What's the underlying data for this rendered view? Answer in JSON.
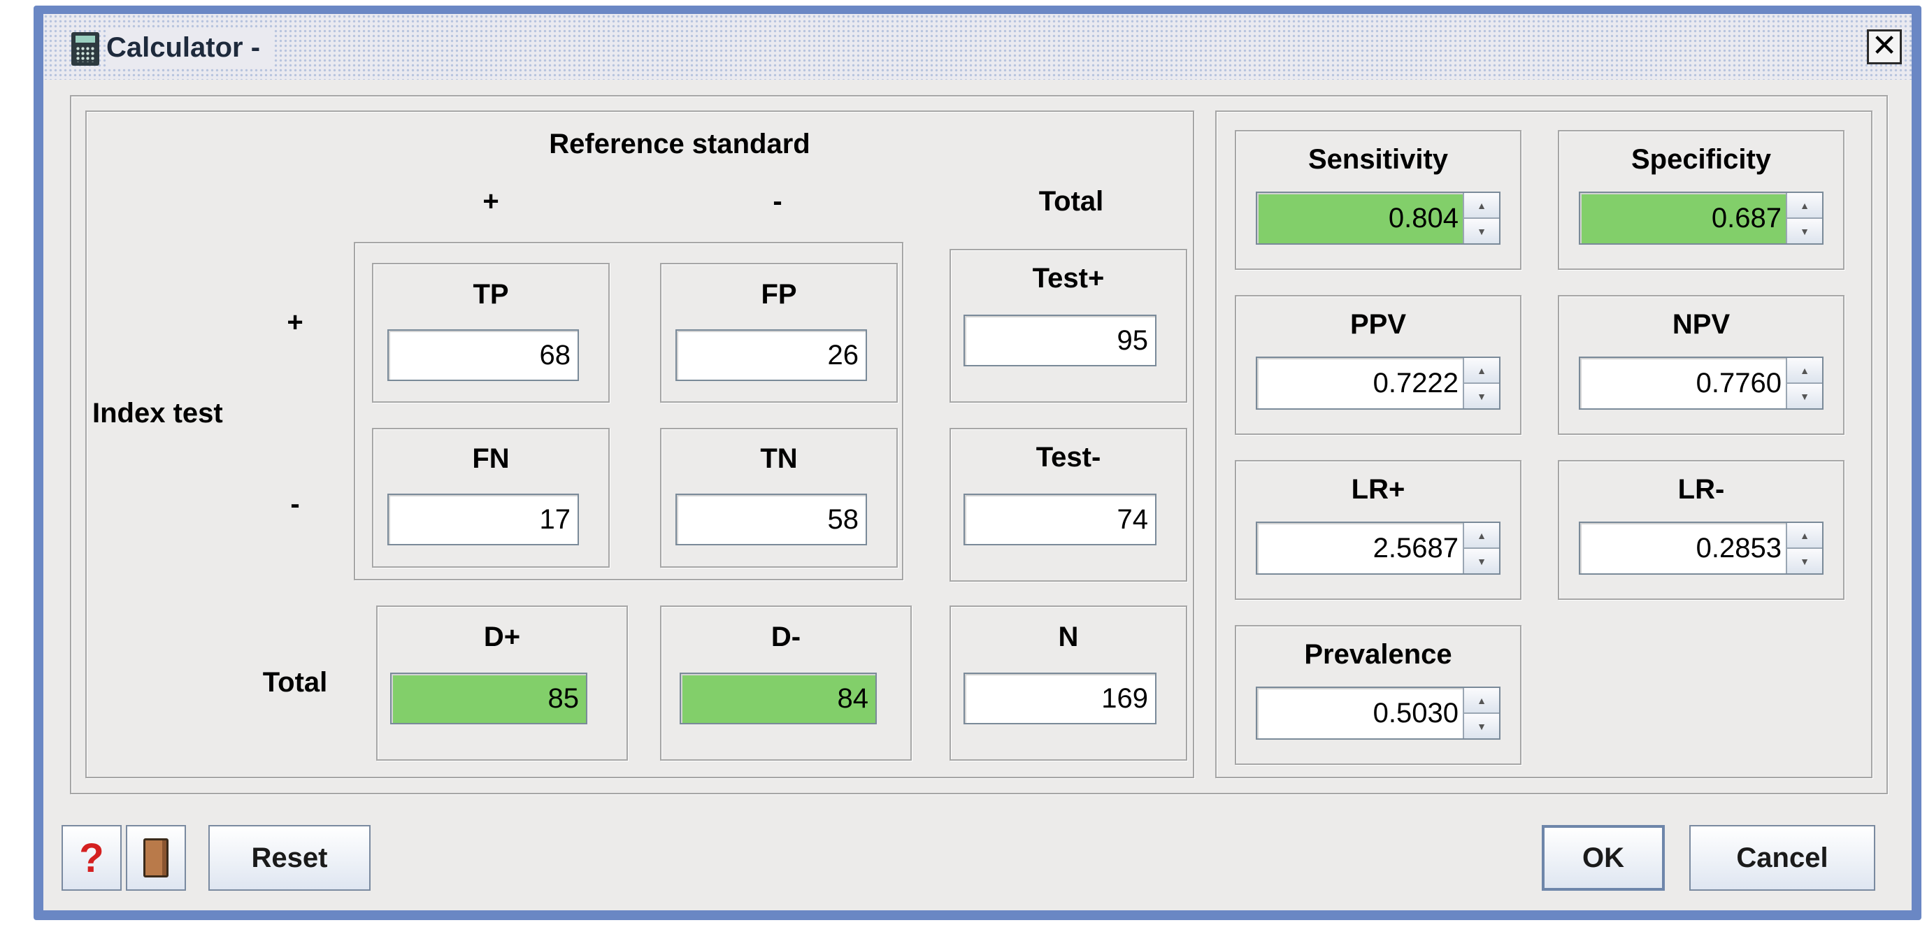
{
  "window": {
    "title": "Calculator -"
  },
  "table": {
    "reference_standard_label": "Reference standard",
    "col_pos": "+",
    "col_neg": "-",
    "col_total": "Total",
    "index_test_label": "Index test",
    "row_pos": "+",
    "row_neg": "-",
    "row_total": "Total",
    "tp": {
      "label": "TP",
      "value": "68"
    },
    "fp": {
      "label": "FP",
      "value": "26"
    },
    "fn": {
      "label": "FN",
      "value": "17"
    },
    "tn": {
      "label": "TN",
      "value": "58"
    },
    "test_pos": {
      "label": "Test+",
      "value": "95"
    },
    "test_neg": {
      "label": "Test-",
      "value": "74"
    },
    "d_pos": {
      "label": "D+",
      "value": "85"
    },
    "d_neg": {
      "label": "D-",
      "value": "84"
    },
    "n": {
      "label": "N",
      "value": "169"
    }
  },
  "stats": {
    "sensitivity": {
      "label": "Sensitivity",
      "value": "0.804"
    },
    "specificity": {
      "label": "Specificity",
      "value": "0.687"
    },
    "ppv": {
      "label": "PPV",
      "value": "0.7222"
    },
    "npv": {
      "label": "NPV",
      "value": "0.7760"
    },
    "lr_pos": {
      "label": "LR+",
      "value": "2.5687"
    },
    "lr_neg": {
      "label": "LR-",
      "value": "0.2853"
    },
    "prevalence": {
      "label": "Prevalence",
      "value": "0.5030"
    }
  },
  "buttons": {
    "help_icon_glyph": "?",
    "reset": "Reset",
    "ok": "OK",
    "cancel": "Cancel"
  },
  "colors": {
    "highlight": "#82cf6a",
    "title_bar": "#6a87c4"
  }
}
